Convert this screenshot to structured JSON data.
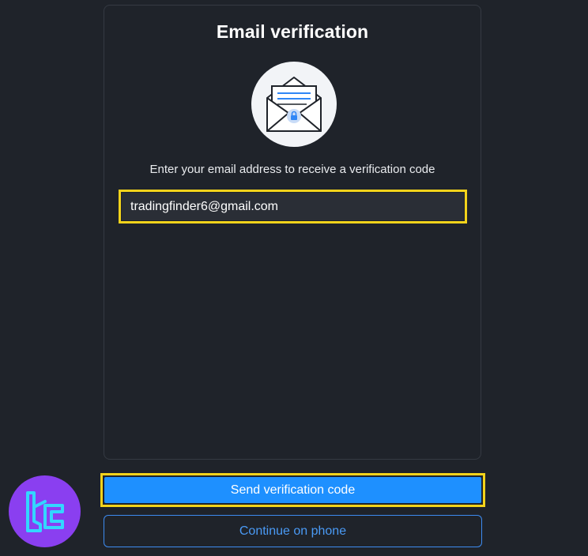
{
  "dialog": {
    "title": "Email verification",
    "subtitle": "Enter your email address to receive a verification code",
    "illustration_icon": "envelope-lock-icon"
  },
  "email_field": {
    "value": "tradingfinder6@gmail.com"
  },
  "buttons": {
    "send_label": "Send verification code",
    "phone_label": "Continue on phone"
  },
  "colors": {
    "background": "#1f232a",
    "primary": "#1e90ff",
    "highlight": "#f3d31b",
    "brand": "#8a3ff0"
  },
  "logo": {
    "icon": "tradingfinder-logo-icon"
  }
}
